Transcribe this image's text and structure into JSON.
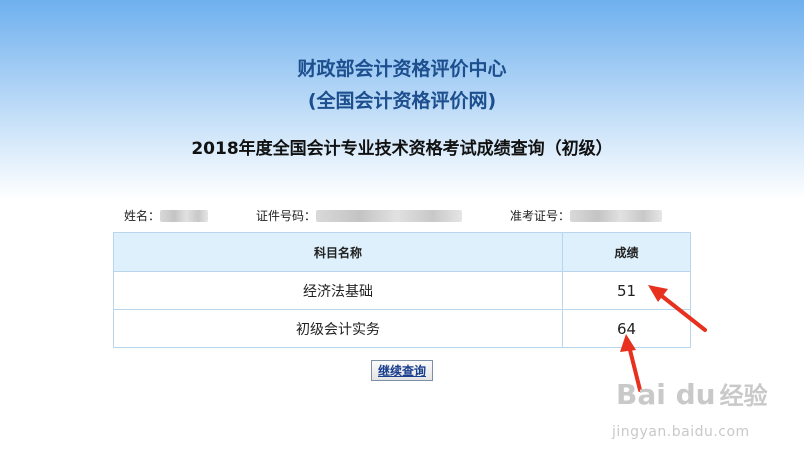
{
  "header": {
    "org_name": "财政部会计资格评价中心",
    "org_site": "(全国会计资格评价网)",
    "title": "2018年度全国会计专业技术资格考试成绩查询（初级）"
  },
  "candidate": {
    "name_label": "姓名：",
    "id_label": "证件号码：",
    "ticket_label": "准考证号："
  },
  "table": {
    "headers": [
      "科目名称",
      "成绩"
    ],
    "rows": [
      {
        "subject": "经济法基础",
        "score": "51"
      },
      {
        "subject": "初级会计实务",
        "score": "64"
      }
    ]
  },
  "actions": {
    "continue_label": "继续查询"
  },
  "annotation_color": "#e8301e",
  "watermark": {
    "logo": "Bai du",
    "text": "经验",
    "url": "jingyan.baidu.com"
  }
}
